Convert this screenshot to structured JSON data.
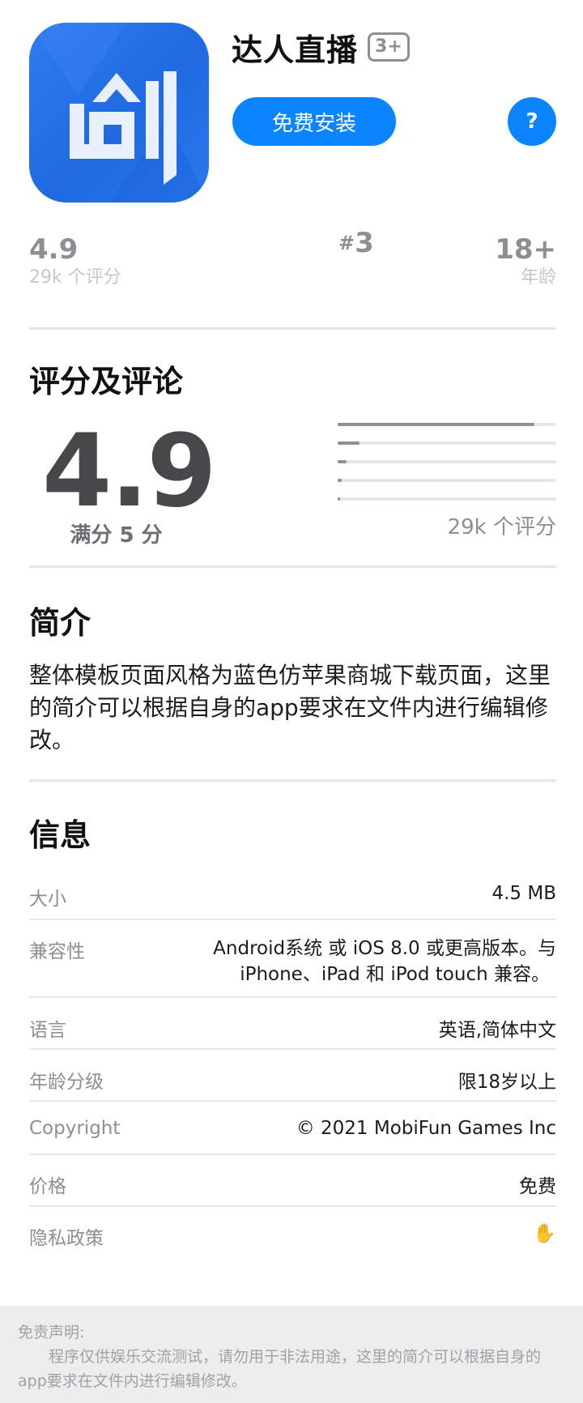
{
  "app": {
    "name": "达人直播",
    "age_badge": "3+",
    "install_label": "免费安装",
    "help_label": "?"
  },
  "stats": {
    "rating": "4.9",
    "rating_count": "29k 个评分",
    "rank_hash": "#",
    "rank": "3",
    "age": "18+",
    "age_label": "年龄"
  },
  "ratings": {
    "title": "评分及评论",
    "score": "4.9",
    "out_of": "满分 5 分",
    "count": "29k 个评分",
    "distribution": [
      0.9,
      0.1,
      0.04,
      0.02,
      0.01
    ]
  },
  "intro": {
    "title": "简介",
    "text": "整体模板页面风格为蓝色仿苹果商城下载页面，这里的简介可以根据自身的app要求在文件内进行编辑修改。"
  },
  "info": {
    "title": "信息",
    "rows": [
      {
        "label": "大小",
        "value": "4.5 MB"
      },
      {
        "label": "兼容性",
        "value_line1": "Android系统 或 iOS 8.0 或更高版本。与",
        "value_line2": "iPhone、iPad 和 iPod touch 兼容。"
      },
      {
        "label": "语言",
        "value": "英语,简体中文"
      },
      {
        "label": "年龄分级",
        "value": "限18岁以上"
      },
      {
        "label": "Copyright",
        "value": "© 2021 MobiFun Games Inc"
      },
      {
        "label": "价格",
        "value": "免费"
      },
      {
        "label": "隐私政策",
        "value": "✋"
      }
    ]
  },
  "footer": {
    "heading": "免责声明:",
    "text": "程序仅供娱乐交流测试，请勿用于非法用途，这里的简介可以根据自身的app要求在文件内进行编辑修改。"
  },
  "colors": {
    "accent": "#0a84ff",
    "icon_bg": "#1f6ae0"
  }
}
